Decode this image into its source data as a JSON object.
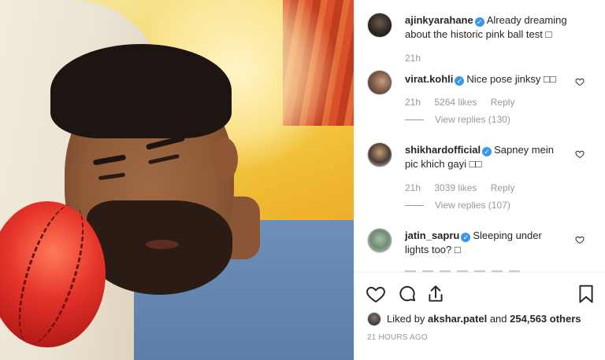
{
  "post": {
    "author": "ajinkyarahane",
    "caption": "Already dreaming about the historic pink ball test",
    "caption_emoji": "□",
    "caption_time": "21h"
  },
  "comments": [
    {
      "user": "virat.kohli",
      "text": "Nice pose jinksy",
      "emoji": "□□",
      "time": "21h",
      "likes": "5264 likes",
      "reply_label": "Reply",
      "view_replies": "View replies (130)"
    },
    {
      "user": "shikhardofficial",
      "text": "Sapney mein pic khich gayi",
      "emoji": "□□",
      "time": "21h",
      "likes": "3039 likes",
      "reply_label": "Reply",
      "view_replies": "View replies (107)"
    },
    {
      "user": "jatin_sapru",
      "text": "Sleeping under lights too?",
      "emoji": "□",
      "time": "",
      "likes": "",
      "reply_label": "",
      "view_replies": ""
    }
  ],
  "likes_summary": {
    "prefix": "Liked by",
    "user": "akshar.patel",
    "middle": "and",
    "others": "254,563 others"
  },
  "post_age": "21 HOURS AGO",
  "icons": {
    "verified": "verified-badge-icon",
    "comment_like": "heart-outline-icon",
    "like": "heart-outline-icon",
    "comment": "comment-bubble-icon",
    "share": "share-icon",
    "save": "bookmark-icon"
  },
  "colors": {
    "text": "#262626",
    "muted": "#999999",
    "verified": "#3897f0",
    "border": "#efefef"
  }
}
